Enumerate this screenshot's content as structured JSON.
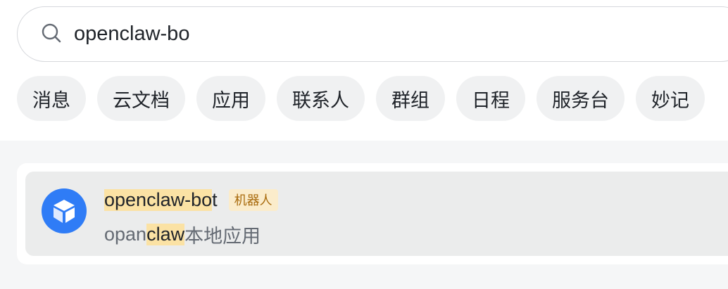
{
  "search": {
    "query": "openclaw-bo",
    "icon": "search-icon"
  },
  "tabs": [
    {
      "label": "消息"
    },
    {
      "label": "云文档"
    },
    {
      "label": "应用"
    },
    {
      "label": "联系人"
    },
    {
      "label": "群组"
    },
    {
      "label": "日程"
    },
    {
      "label": "服务台"
    },
    {
      "label": "妙记"
    }
  ],
  "results": [
    {
      "name_match": "openclaw-bo",
      "name_rest": "t",
      "tag": "机器人",
      "desc_pre": "opan",
      "desc_match": "claw",
      "desc_post": "本地应用",
      "avatar_icon": "cube-icon",
      "avatar_color": "#2f7cf6"
    }
  ],
  "colors": {
    "highlight": "#fbe2a4",
    "tag_bg": "#fbeccb",
    "tag_text": "#a86a0c"
  }
}
